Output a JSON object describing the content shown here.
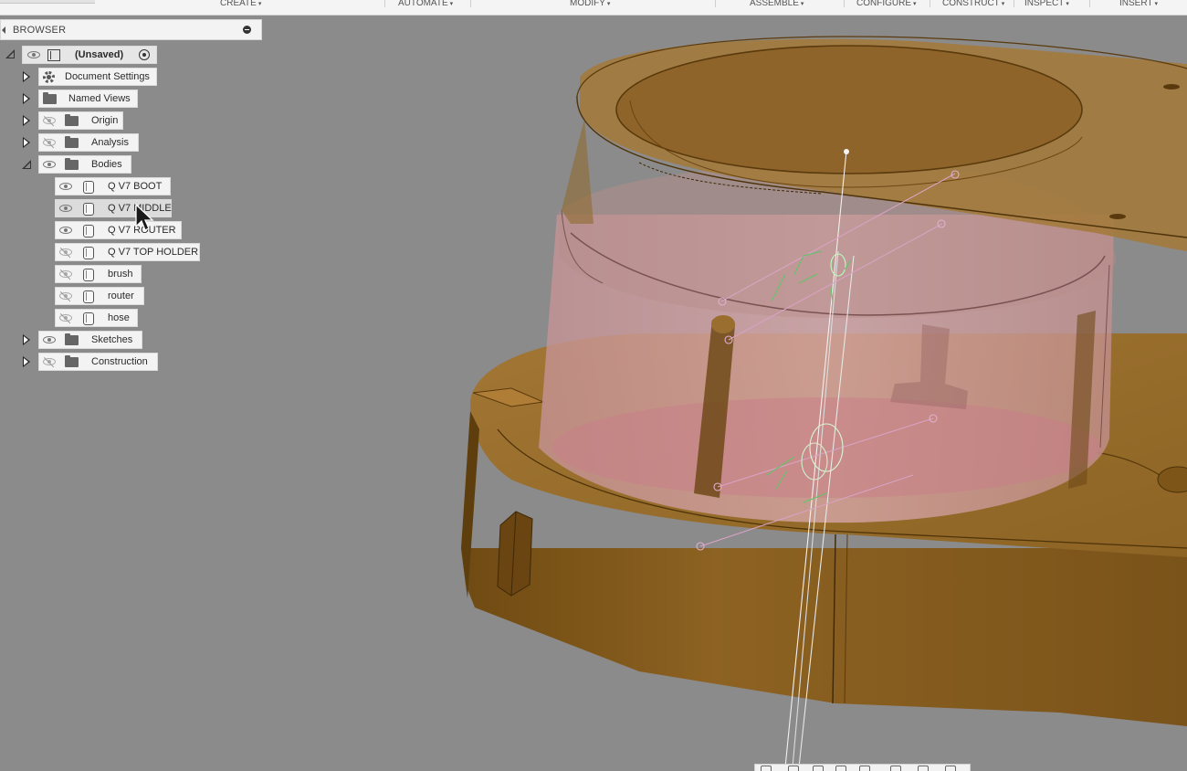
{
  "toolbar": {
    "menus": [
      {
        "label": "CREATE",
        "caret": "▾"
      },
      {
        "label": "AUTOMATE",
        "caret": "▾"
      },
      {
        "label": "MODIFY",
        "caret": "▾"
      },
      {
        "label": "ASSEMBLE",
        "caret": "▾"
      },
      {
        "label": "CONFIGURE",
        "caret": "▾"
      },
      {
        "label": "CONSTRUCT",
        "caret": "▾"
      },
      {
        "label": "INSPECT",
        "caret": "▾"
      },
      {
        "label": "INSERT",
        "caret": "▾"
      }
    ]
  },
  "browser": {
    "title": "BROWSER",
    "root": {
      "label": "(Unsaved)"
    },
    "nodes": {
      "document_settings": "Document Settings",
      "named_views": "Named Views",
      "origin": "Origin",
      "analysis": "Analysis",
      "bodies": "Bodies",
      "sketches": "Sketches",
      "construction": "Construction"
    },
    "bodies": [
      {
        "label": "Q V7 BOOT",
        "visible": true
      },
      {
        "label": "Q V7 MIDDLE",
        "visible": true
      },
      {
        "label": "Q V7 ROUTER",
        "visible": true
      },
      {
        "label": "Q V7 TOP HOLDER",
        "visible": false
      },
      {
        "label": "brush",
        "visible": false
      },
      {
        "label": "router",
        "visible": false
      },
      {
        "label": "hose",
        "visible": false
      }
    ]
  },
  "icons": {
    "visibility_on": "eye-icon",
    "visibility_off": "eye-hidden-icon",
    "folder": "folder-icon",
    "settings": "gear-icon",
    "body": "body-icon",
    "component": "component-icon",
    "active": "radio-active-icon"
  },
  "colors": {
    "viewport_background": "#8c8b8b",
    "model_wood": "#8a5e20",
    "model_transparent_pink": "#d8a0a6",
    "sketch_green": "#63c36a"
  }
}
